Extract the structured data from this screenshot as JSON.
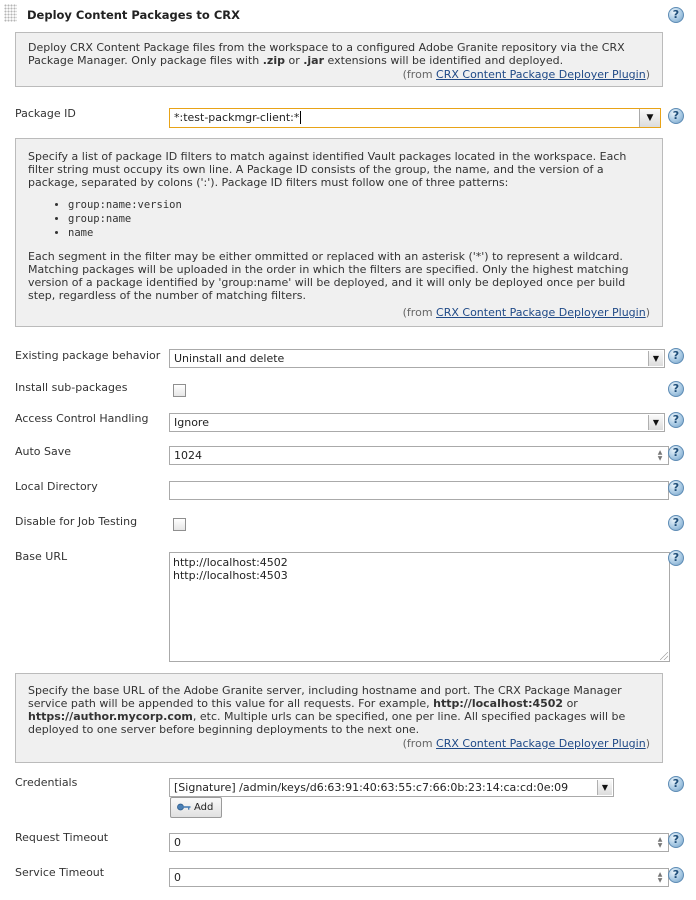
{
  "section": {
    "title": "Deploy Content Packages to CRX",
    "description_parts": [
      "Deploy CRX Content Package files from the workspace to a configured Adobe Granite repository via the CRX Package Manager. Only package files with ",
      ".zip",
      " or ",
      ".jar",
      " extensions will be identified and deployed."
    ],
    "from_prefix": "(from ",
    "from_link": "CRX Content Package Deployer Plugin",
    "from_suffix": ")"
  },
  "package_id": {
    "label": "Package ID",
    "value": "*:test-packmgr-client:*",
    "help_intro": "Specify a list of package ID filters to match against identified Vault packages located in the workspace. Each filter string must occupy its own line. A Package ID consists of the group, the name, and the version of a package, separated by colons (':'). Package ID filters must follow one of three patterns:",
    "patterns": [
      "group:name:version",
      "group:name",
      "name"
    ],
    "help_outro": "Each segment in the filter may be either ommitted or replaced with an asterisk ('*') to represent a wildcard. Matching packages will be uploaded in the order in which the filters are specified. Only the highest matching version of a package identified by 'group:name' will be deployed, and it will only be deployed once per build step, regardless of the number of matching filters."
  },
  "existing_package_behavior": {
    "label": "Existing package behavior",
    "value": "Uninstall and delete"
  },
  "install_sub_packages": {
    "label": "Install sub-packages",
    "checked": false
  },
  "access_control_handling": {
    "label": "Access Control Handling",
    "value": "Ignore"
  },
  "auto_save": {
    "label": "Auto Save",
    "value": "1024"
  },
  "local_directory": {
    "label": "Local Directory",
    "value": ""
  },
  "disable_for_job_testing": {
    "label": "Disable for Job Testing",
    "checked": false
  },
  "base_url": {
    "label": "Base URL",
    "values": [
      "http://localhost:4502",
      "http://localhost:4503"
    ],
    "help_parts": [
      "Specify the base URL of the Adobe Granite server, including hostname and port. The CRX Package Manager service path will be appended to this value for all requests. For example, ",
      "http://localhost:4502",
      " or ",
      "https://author.mycorp.com",
      ", etc. Multiple urls can be specified, one per line. All specified packages will be deployed to one server before beginning deployments to the next one."
    ]
  },
  "credentials": {
    "label": "Credentials",
    "value": "[Signature] /admin/keys/d6:63:91:40:63:55:c7:66:0b:23:14:ca:cd:0e:09",
    "add_label": "Add"
  },
  "request_timeout": {
    "label": "Request Timeout",
    "value": "0"
  },
  "service_timeout": {
    "label": "Service Timeout",
    "value": "0"
  },
  "icons": {
    "help": "?",
    "dropdown": "▼",
    "spinner_up": "▲",
    "spinner_down": "▼"
  },
  "colors": {
    "help_box_bg": "#f0f0f0",
    "focus_border": "#e8a317",
    "link": "#204a87"
  }
}
